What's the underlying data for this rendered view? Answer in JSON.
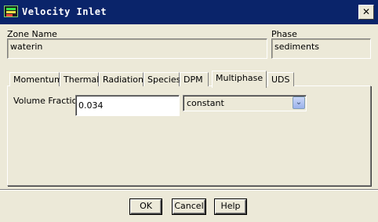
{
  "window": {
    "title": "Velocity Inlet",
    "close_glyph": "✕"
  },
  "zone": {
    "label": "Zone Name",
    "value": "waterin"
  },
  "phase": {
    "label": "Phase",
    "value": "sediments"
  },
  "tabs": [
    "Momentum",
    "Thermal",
    "Radiation",
    "Species",
    "DPM",
    "Multiphase",
    "UDS"
  ],
  "active_tab": "Multiphase",
  "multiphase": {
    "volume_fraction_label": "Volume Fraction",
    "volume_fraction_value": "0.034",
    "method": "constant",
    "dropdown_glyph": "⌄"
  },
  "buttons": {
    "ok": "OK",
    "cancel": "Cancel",
    "help": "Help"
  },
  "colors": {
    "titlebar": "#0A246A",
    "dialog_bg": "#ECE9D8"
  }
}
